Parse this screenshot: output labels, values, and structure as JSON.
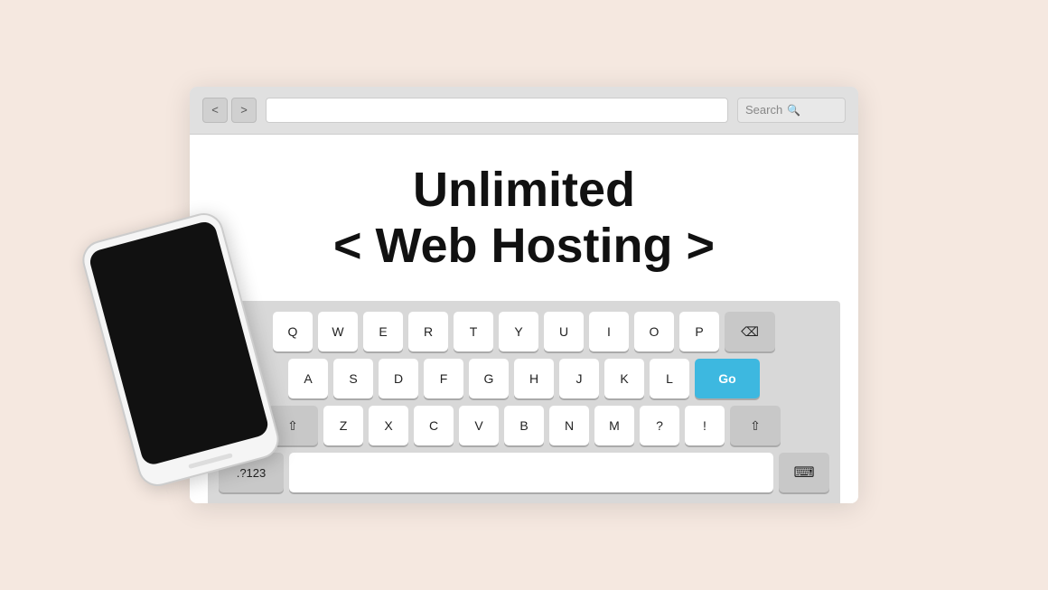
{
  "page": {
    "bg_color": "#f5e8e0"
  },
  "browser": {
    "nav_back": "<",
    "nav_forward": ">",
    "search_placeholder": "Search",
    "search_icon": "🔍"
  },
  "heading": {
    "line1": "Unlimited",
    "line2": "< Web Hosting >"
  },
  "keyboard": {
    "rows": [
      [
        "Q",
        "W",
        "E",
        "R",
        "T",
        "Y",
        "U",
        "I",
        "O",
        "P"
      ],
      [
        "A",
        "S",
        "D",
        "F",
        "G",
        "H",
        "J",
        "K",
        "L"
      ],
      [
        "Z",
        "X",
        "C",
        "V",
        "B",
        "N",
        "M",
        "?",
        "!"
      ]
    ],
    "go_label": "Go",
    "numbers_label": ".?123",
    "backspace_icon": "⌫",
    "shift_icon": "⇧",
    "keyboard_icon": "⌨"
  },
  "phone": {
    "has_screen": true
  }
}
